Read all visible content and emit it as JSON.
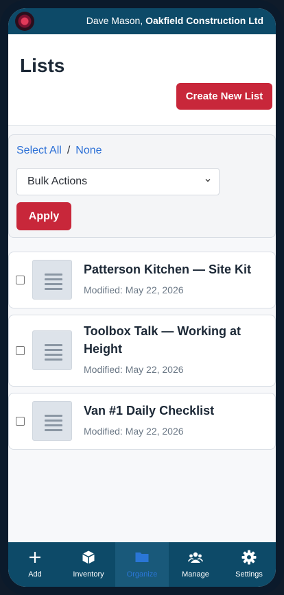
{
  "topbar": {
    "user_name": "Dave Mason,",
    "company": "Oakfield Construction Ltd",
    "logo_icon": "company-logo"
  },
  "header": {
    "title": "Lists",
    "create_label": "Create New List"
  },
  "bulk": {
    "select_all": "Select All",
    "separator": "/",
    "select_none": "None",
    "action_value": "Bulk Actions",
    "apply_label": "Apply"
  },
  "lists": [
    {
      "title": "Patterson Kitchen — Site Kit",
      "modified": "Modified: May 22, 2026",
      "checked": false
    },
    {
      "title": "Toolbox Talk — Working at Height",
      "modified": "Modified: May 22, 2026",
      "checked": false
    },
    {
      "title": "Van #1 Daily Checklist",
      "modified": "Modified: May 22, 2026",
      "checked": false
    }
  ],
  "tabs": [
    {
      "label": "Add",
      "icon": "plus-icon",
      "active": false
    },
    {
      "label": "Inventory",
      "icon": "box-icon",
      "active": false
    },
    {
      "label": "Organize",
      "icon": "folder-icon",
      "active": true
    },
    {
      "label": "Manage",
      "icon": "people-icon",
      "active": false
    },
    {
      "label": "Settings",
      "icon": "gear-icon",
      "active": false
    }
  ],
  "colors": {
    "brand_bar": "#0d4a68",
    "accent_red": "#c8273a",
    "link_blue": "#2b6fd6"
  }
}
